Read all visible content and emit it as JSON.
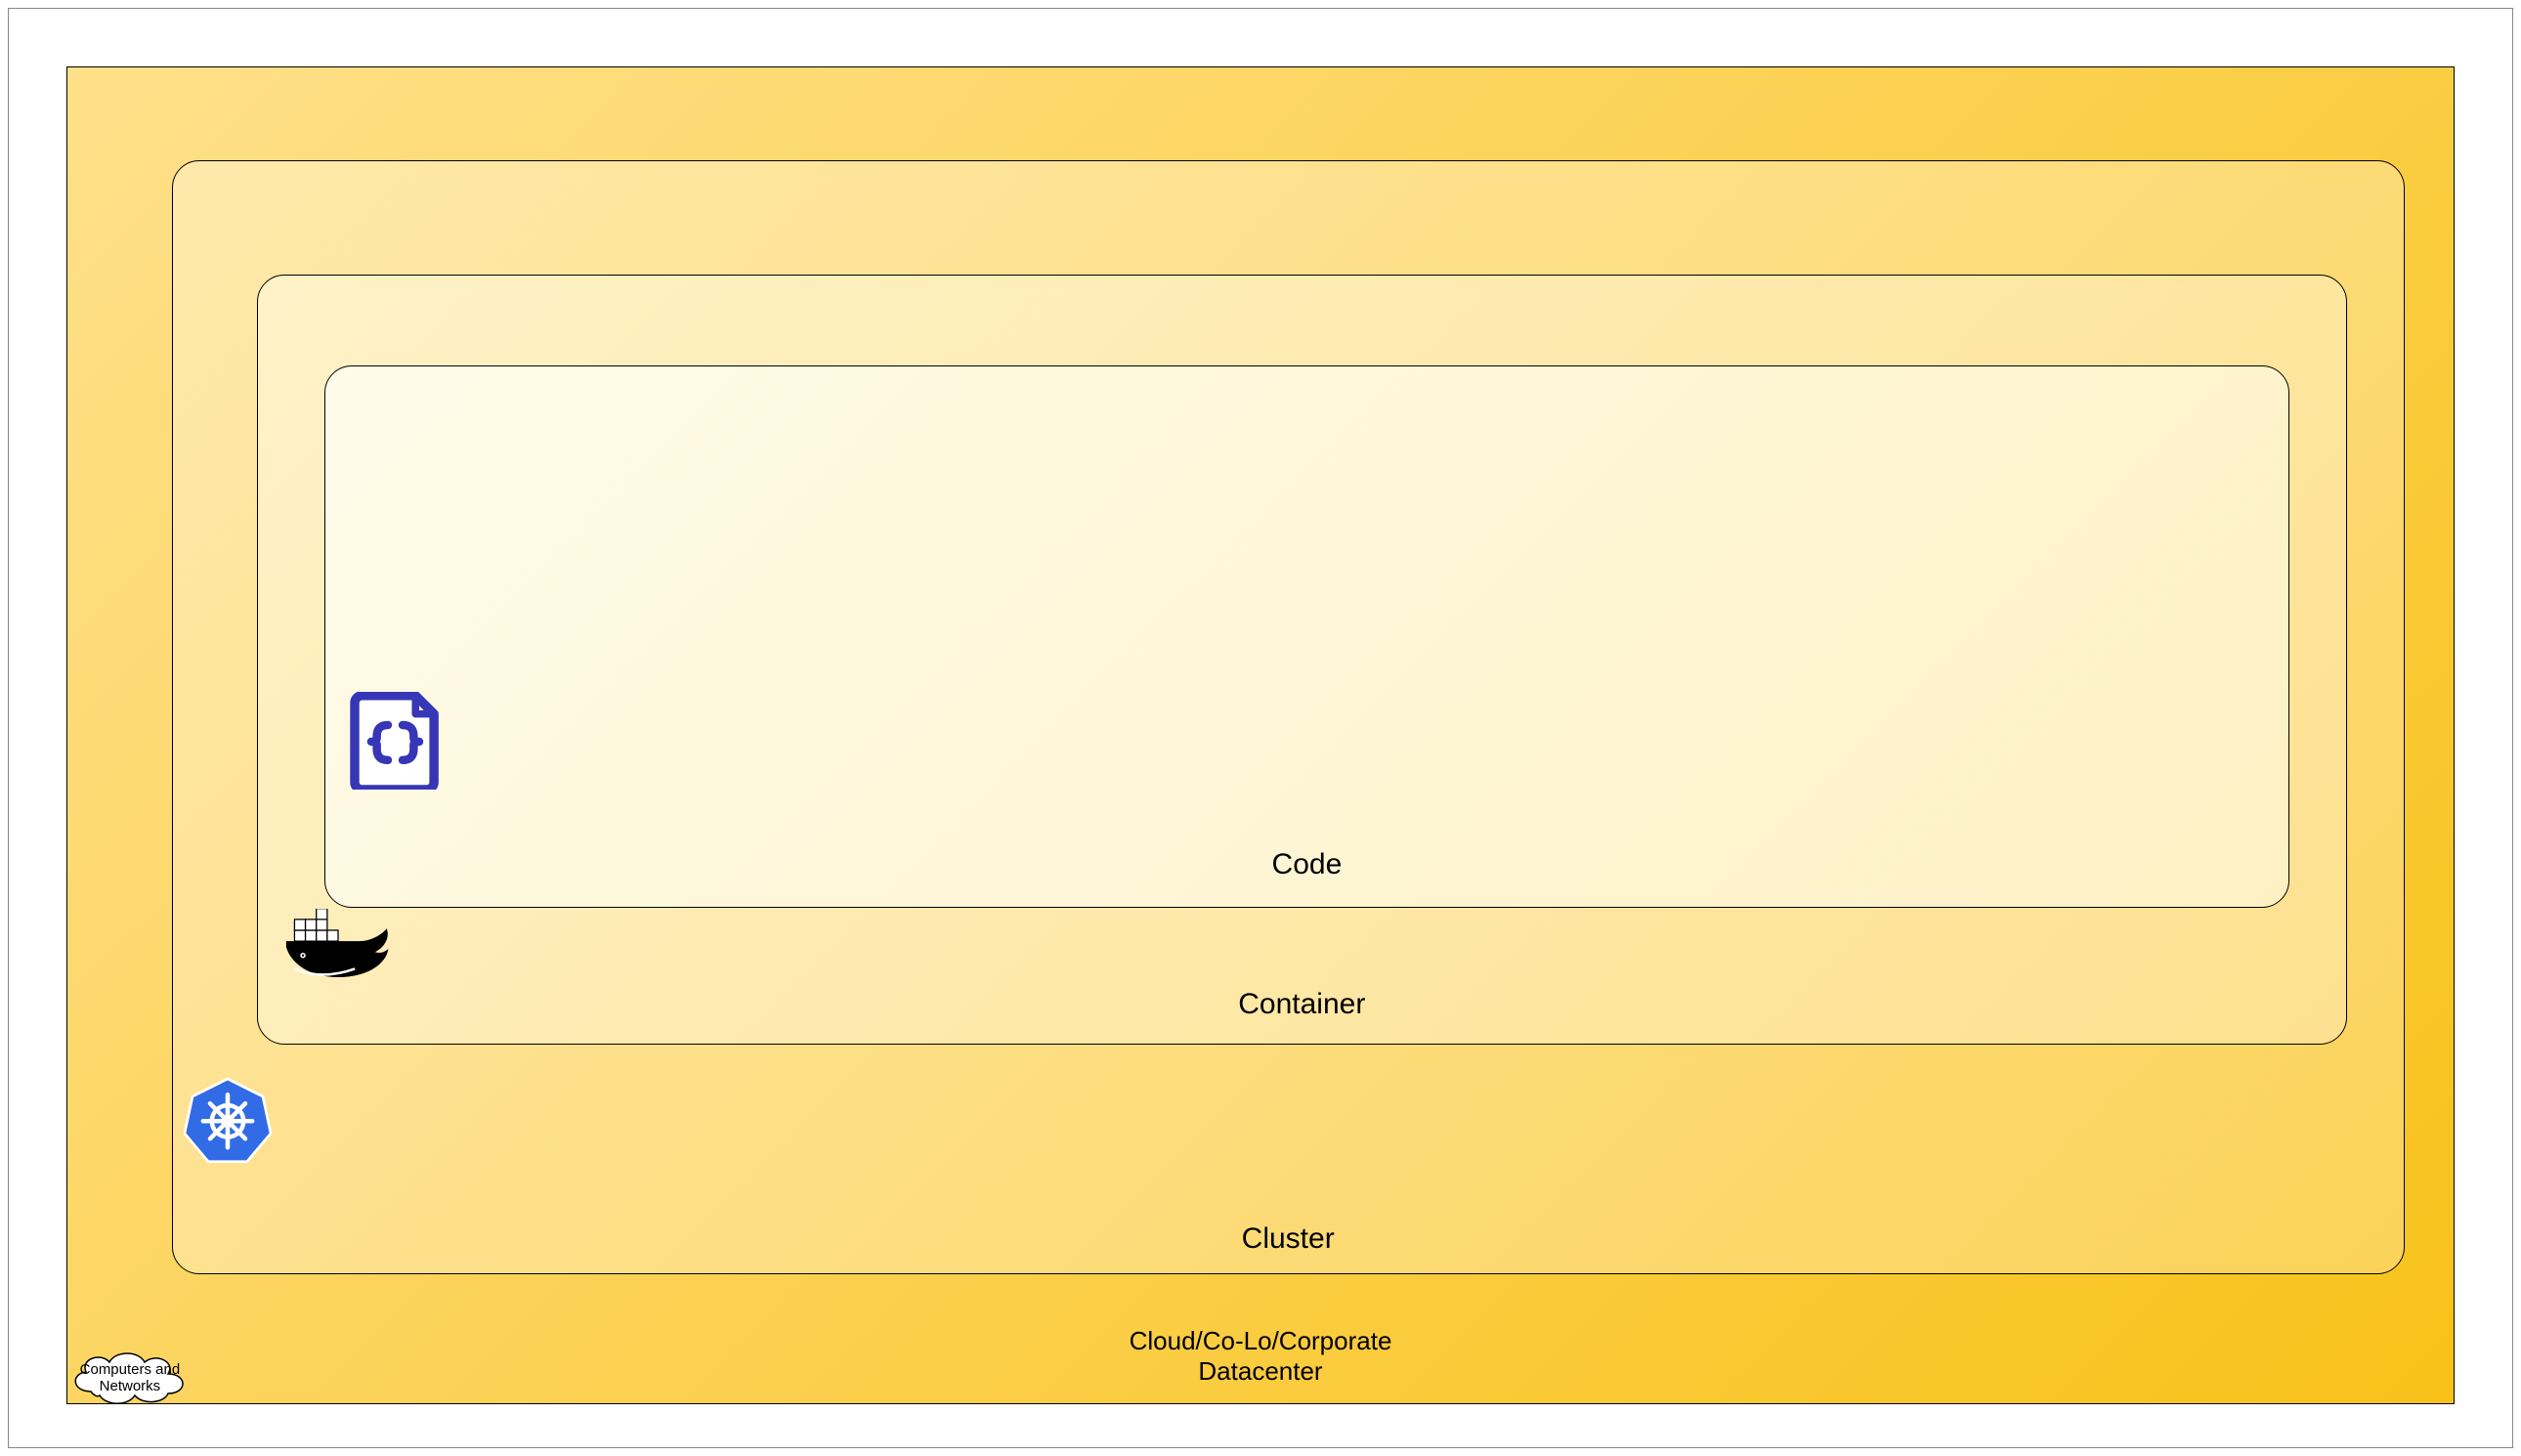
{
  "layers": {
    "datacenter": {
      "label": "Cloud/Co-Lo/Corporate\nDatacenter"
    },
    "cluster": {
      "label": "Cluster"
    },
    "container": {
      "label": "Container"
    },
    "code": {
      "label": "Code"
    }
  },
  "cloud_callout": {
    "text": "Computers and Networks"
  },
  "icons": {
    "code": "code-file-icon",
    "docker": "docker-whale-icon",
    "k8s": "kubernetes-icon"
  },
  "colors": {
    "outer_start": "#ffe08a",
    "outer_end": "#f8c21a",
    "cluster_start": "#ffe9ab",
    "cluster_end": "#fbd35a",
    "container_start": "#fff2c9",
    "container_end": "#fde18f",
    "code_start": "#fffbe9",
    "code_end": "#fdf1c4",
    "icon_blue": "#3636b7",
    "k8s_blue": "#316ce6"
  }
}
